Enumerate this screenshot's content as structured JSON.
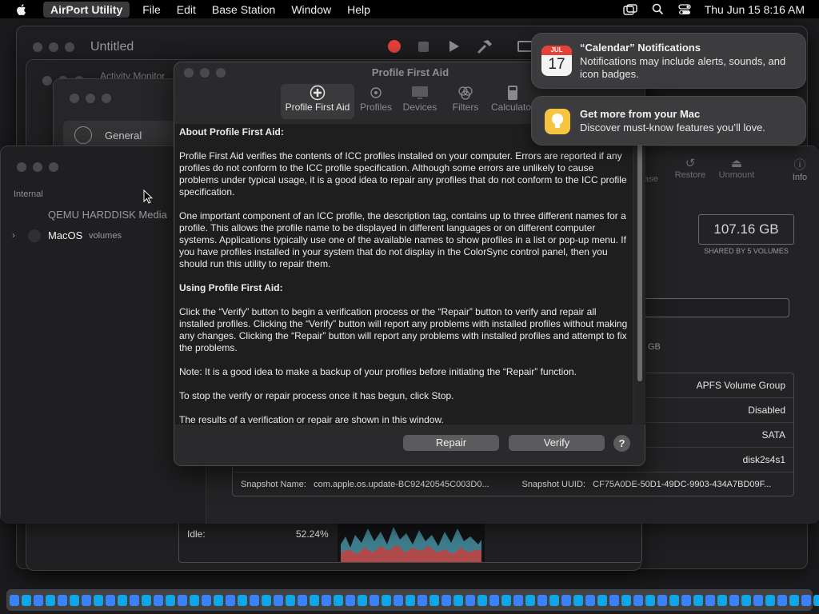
{
  "menubar": {
    "app_name": "AirPort Utility",
    "menus": [
      "File",
      "Edit",
      "Base Station",
      "Window",
      "Help"
    ],
    "clock": "Thu Jun 15  8:16 AM"
  },
  "windows": {
    "untitled_title": "Untitled",
    "activity_title": "Activity Monitor",
    "general_label": "General"
  },
  "disk_utility": {
    "section_internal": "Internal",
    "disk_name": "QEMU HARDDISK Media",
    "volume_name": "MacOS",
    "volume_sub": "volumes",
    "toolbar": [
      "Restore",
      "Unmount",
      "Info"
    ],
    "toolbar_partial": "ase",
    "capacity": "107.16 GB",
    "capacity_caption": "SHARED BY 5 VOLUMES",
    "gb_partial": "GB",
    "info_rows": [
      "APFS Volume Group",
      "Disabled",
      "SATA",
      "disk2s4s1"
    ],
    "snapshot_name_label": "Snapshot Name:",
    "snapshot_name_value": "com.apple.os.update-BC92420545C003D0...",
    "snapshot_uuid_label": "Snapshot UUID:",
    "snapshot_uuid_value": "CF75A0DE-50D1-49DC-9903-434A7BD09F..."
  },
  "activity": {
    "idle_label": "Idle:",
    "idle_value": "52.24%"
  },
  "pfa": {
    "title": "Profile First Aid",
    "tabs": [
      "Profile First Aid",
      "Profiles",
      "Devices",
      "Filters",
      "Calculator"
    ],
    "about_heading": "About Profile First Aid:",
    "para1": "Profile First Aid verifies the contents of ICC profiles installed on your computer. Errors are reported if any profiles do not conform to the ICC profile specification. Although some errors are unlikely to cause problems under typical usage, it is a good idea to repair any profiles that do not conform to the ICC profile specification.",
    "para2": "One important component of an ICC profile, the description tag, contains up to three different names for a profile. This allows the profile name to be displayed in different languages or on different computer systems. Applications typically use one of the available names to show profiles in a list or pop-up menu. If you have profiles installed in your system that do not display in the ColorSync control panel, then you should run this utility to repair them.",
    "using_heading": "Using Profile First Aid:",
    "para3": "Click the “Verify” button to begin a verification process or the “Repair” button to verify and repair all installed profiles. Clicking the “Verify” button will report any problems with installed profiles without making any changes. Clicking the “Repair” button will report any problems with installed profiles and attempt to fix the problems.",
    "para4": "Note: It is a good idea to make a backup of your profiles before initiating the “Repair” function.",
    "para5": "To stop the verify or repair process once it has begun, click Stop.",
    "para6": "The results of a verification or repair are shown in this window.",
    "repair_label": "Repair",
    "verify_label": "Verify",
    "help_label": "?"
  },
  "notifications": [
    {
      "calendar_month": "JUL",
      "calendar_day": "17",
      "title": "“Calendar” Notifications",
      "body": "Notifications may include alerts, sounds, and icon badges."
    },
    {
      "title": "Get more from your Mac",
      "body": "Discover must-know features you’ll love."
    }
  ],
  "colors": {
    "record": "#e5403a",
    "tips": "#f5c542",
    "calendar_red": "#e5403a"
  }
}
